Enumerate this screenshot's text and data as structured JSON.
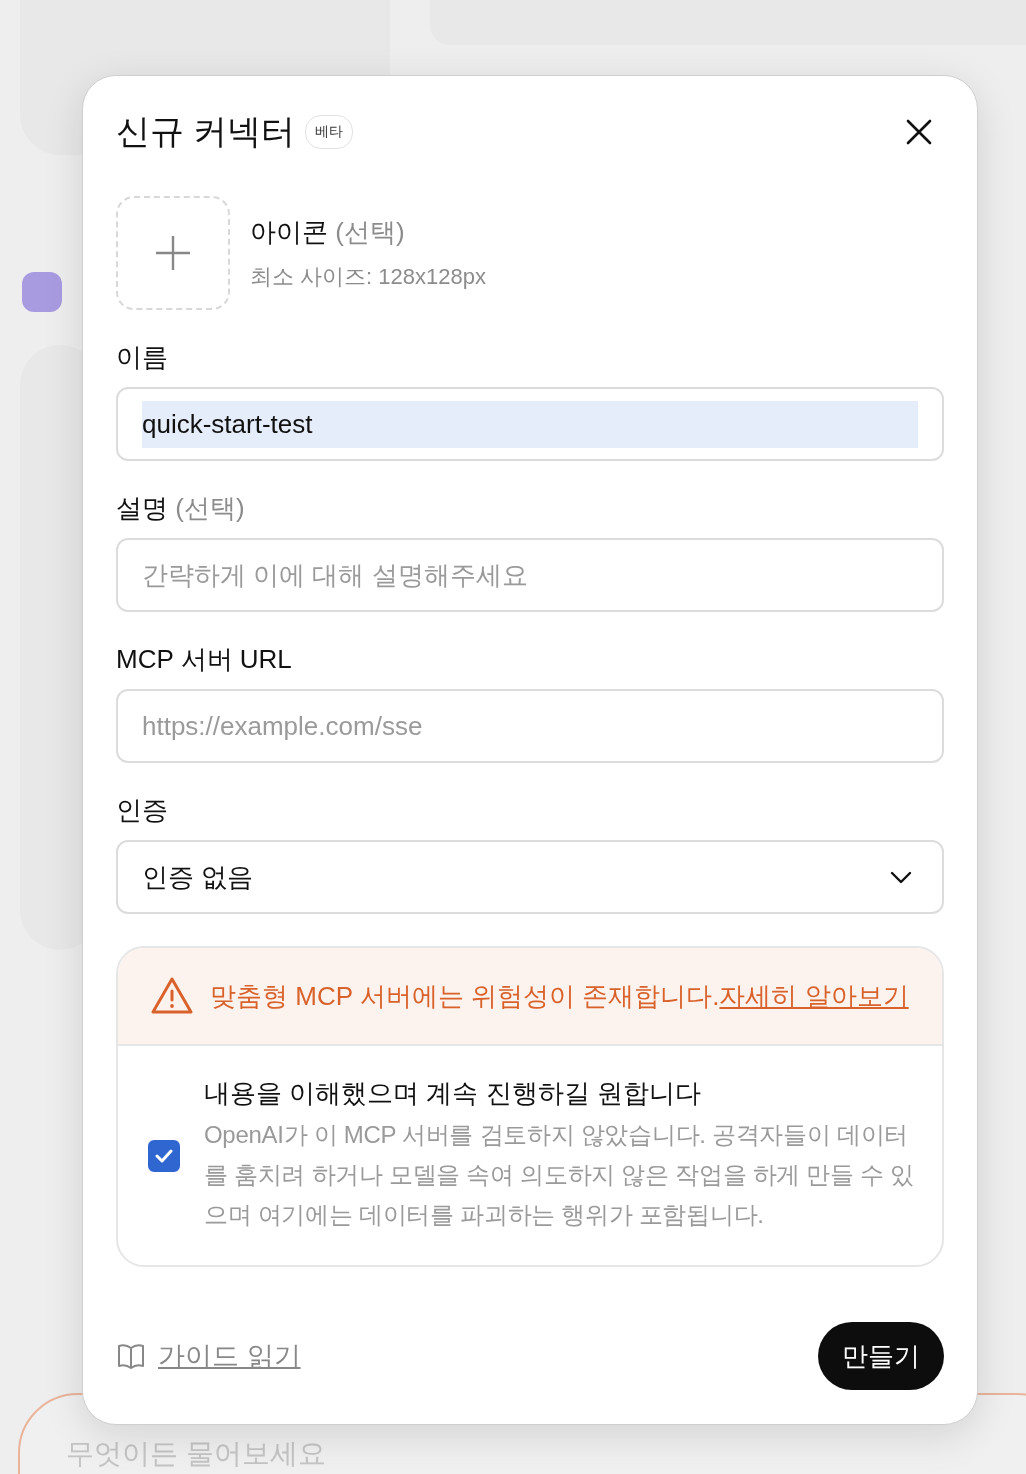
{
  "background": {
    "chat_placeholder": "무엇이든 물어보세요"
  },
  "dialog": {
    "title": "신규 커넥터",
    "badge": "베타",
    "icon_upload": {
      "label": "아이콘",
      "optional": "(선택)",
      "hint": "최소 사이즈: 128x128px"
    },
    "fields": [
      {
        "kind": "text",
        "label": "이름",
        "value": "quick-start-test",
        "text_selected": true
      },
      {
        "kind": "text",
        "label": "설명",
        "optional": "(선택)",
        "placeholder": "간략하게 이에 대해 설명해주세요"
      },
      {
        "kind": "text",
        "label": "MCP 서버 URL",
        "placeholder": "https://example.com/sse"
      },
      {
        "kind": "select",
        "label": "인증",
        "value": "인증 없음"
      }
    ],
    "warning": {
      "message": "맞춤형 MCP 서버에는 위험성이 존재합니다.",
      "link": "자세히 알아보기",
      "consent": {
        "checked": true,
        "title": "내용을 이해했으며 계속 진행하길 원합니다",
        "body": "OpenAI가 이 MCP 서버를 검토하지 않았습니다. 공격자들이 데이터를 훔치려 하거나 모델을 속여 의도하지 않은 작업을 하게 만들 수 있으며 여기에는 데이터를 파괴하는 행위가 포함됩니다."
      }
    },
    "footer": {
      "guide_link": "가이드 읽기",
      "create_button": "만들기"
    }
  }
}
